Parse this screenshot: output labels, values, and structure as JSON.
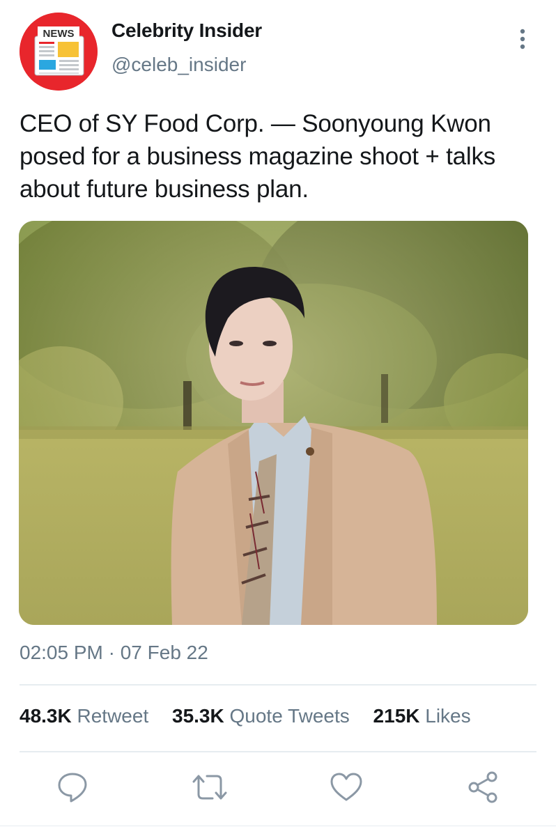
{
  "author": {
    "name": "Celebrity Insider",
    "handle": "@celeb_insider",
    "avatar_label": "NEWS",
    "avatar_icon": "newspaper-icon"
  },
  "menu_icon": "more-vertical-icon",
  "tweet": {
    "text": "CEO of SY Food Corp. — Soonyoung Kwon posed for a business magazine shoot + talks about future business plan.",
    "media": "photo",
    "timestamp": "02:05 PM · 07 Feb 22"
  },
  "stats": [
    {
      "count": "48.3K",
      "label": "Retweet"
    },
    {
      "count": "35.3K",
      "label": "Quote Tweets"
    },
    {
      "count": "215K",
      "label": "Likes"
    }
  ],
  "actions": [
    {
      "icon": "reply-icon"
    },
    {
      "icon": "retweet-icon"
    },
    {
      "icon": "like-icon"
    },
    {
      "icon": "share-icon"
    }
  ],
  "colors": {
    "text": "#14171a",
    "secondary": "#657786",
    "icon": "#8b98a5",
    "divider": "#e6ecf0",
    "avatar_red": "#e8262c"
  }
}
